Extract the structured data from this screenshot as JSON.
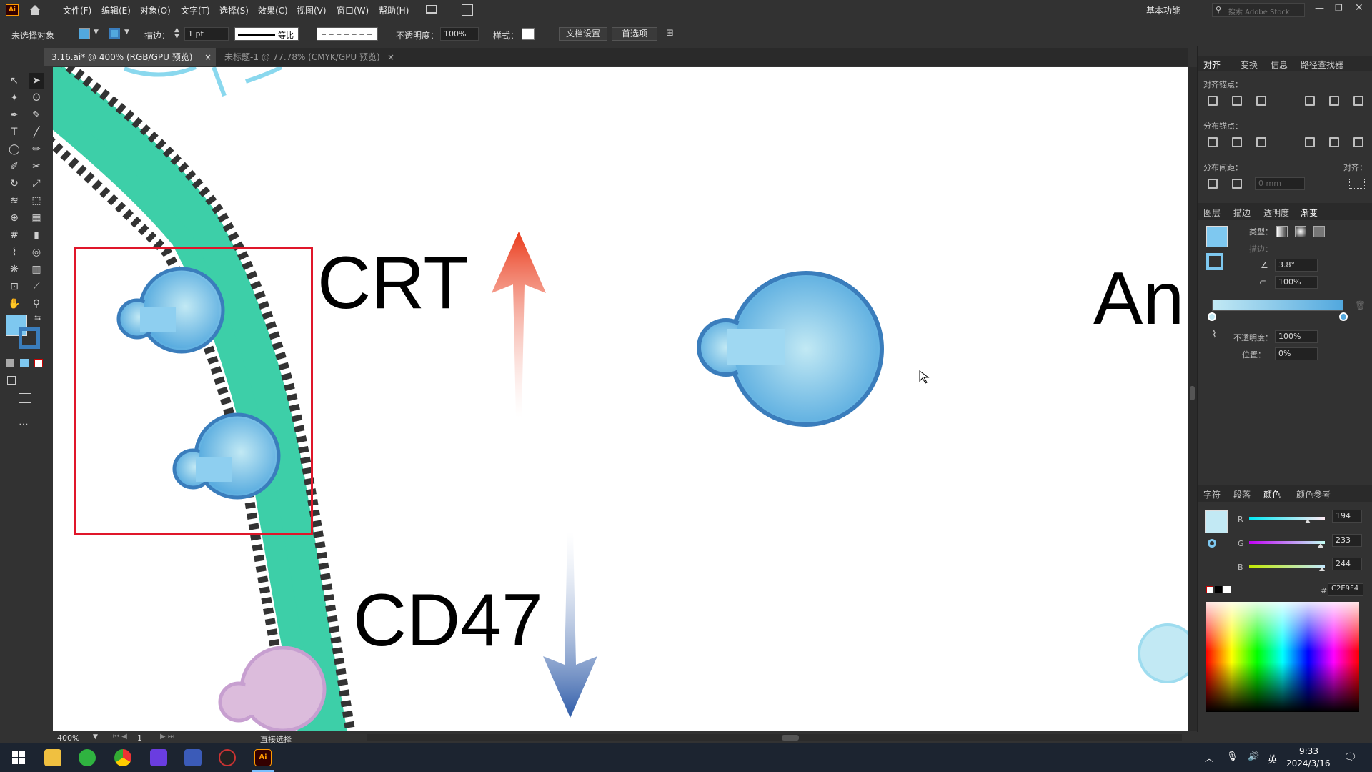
{
  "menubar": {
    "app_badge": "Ai",
    "items": [
      "文件(F)",
      "编辑(E)",
      "对象(O)",
      "文字(T)",
      "选择(S)",
      "效果(C)",
      "视图(V)",
      "窗口(W)",
      "帮助(H)"
    ],
    "workspace": "基本功能",
    "search_placeholder": "搜索 Adobe Stock"
  },
  "control": {
    "selection": "未选择对象",
    "stroke_label": "描边：",
    "stroke_value": "1 pt",
    "stroke_profile": "等比",
    "opacity_label": "不透明度：",
    "opacity_value": "100%",
    "style_label": "样式：",
    "doc_setup": "文档设置",
    "preferences": "首选项"
  },
  "tabs": [
    {
      "label": "3.16.ai* @ 400% (RGB/GPU 预览)",
      "active": true
    },
    {
      "label": "未标题-1 @ 77.78% (CMYK/GPU 预览)",
      "active": false
    }
  ],
  "canvas": {
    "label_crt": "CRT",
    "label_cd47": "CD47",
    "label_an": "An",
    "colors": {
      "membrane": "#3dcfa8",
      "cell_blue": "#52a8de",
      "cell_border": "#3a7dbc",
      "pink": "#d9b8d9",
      "red_arrow": "#ea4a2a",
      "blue_arrow": "#2e5ba8",
      "selection_box": "#e0162a"
    }
  },
  "right_panel": {
    "top_tabs": [
      "对齐",
      "变换",
      "信息",
      "路径查找器"
    ],
    "align_anchor": "对齐锚点：",
    "distribute_anchor": "分布锚点：",
    "distribute_spacing": "分布间距：",
    "align_to": "对齐：",
    "spacing_value": "0 mm",
    "mid_tabs": [
      "图层",
      "描边",
      "透明度",
      "渐变"
    ],
    "gradient_type_label": "类型：",
    "gradient_stroke_label": "描边：",
    "angle_value": "3.8°",
    "aspect_value": "100%",
    "opacity_label": "不透明度：",
    "opacity_value": "100%",
    "location_label": "位置：",
    "location_value": "0%",
    "bottom_tabs": [
      "字符",
      "段落",
      "颜色",
      "颜色参考"
    ],
    "r_label": "R",
    "r_value": "194",
    "g_label": "G",
    "g_value": "233",
    "b_label": "B",
    "b_value": "244",
    "hex_label": "#",
    "hex_value": "C2E9F4"
  },
  "status": {
    "zoom": "400%",
    "artboard": "1",
    "tool_name": "直接选择"
  },
  "taskbar": {
    "lang": "英",
    "time": "9:33",
    "date": "2024/3/16"
  }
}
